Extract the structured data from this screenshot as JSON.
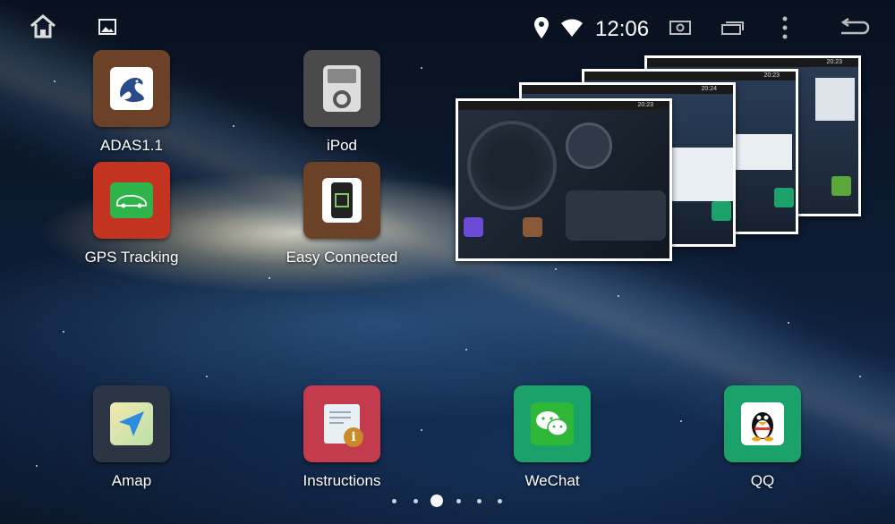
{
  "status_bar": {
    "time": "12:06",
    "icons": [
      "home-icon",
      "gallery-icon",
      "location-icon",
      "wifi-icon",
      "screenshot-icon",
      "recent-apps-icon",
      "overflow-menu-icon",
      "back-icon"
    ]
  },
  "apps": {
    "adas": {
      "label": "ADAS1.1",
      "color": "#6b4127",
      "icon": "dragon-icon"
    },
    "ipod": {
      "label": "iPod",
      "color": "#4a4a4a",
      "icon": "ipod-icon"
    },
    "gps": {
      "label": "GPS Tracking",
      "color": "#c2341f",
      "icon": "car-icon"
    },
    "easy": {
      "label": "Easy Connected",
      "color": "#6b4127",
      "icon": "phone-link-icon"
    },
    "amap": {
      "label": "Amap",
      "color": "#2b3543",
      "icon": "navigation-arrow-icon"
    },
    "instructions": {
      "label": "Instructions",
      "color": "#c33b4c",
      "icon": "document-info-icon"
    },
    "wechat": {
      "label": "WeChat",
      "color": "#1ba16a",
      "icon": "wechat-icon"
    },
    "qq": {
      "label": "QQ",
      "color": "#1ba16a",
      "icon": "penguin-icon"
    }
  },
  "recents": {
    "card1_time": "20:23",
    "card2_time": "20:24",
    "card4_time": "20:23"
  },
  "pager": {
    "pages": 6,
    "current": 3
  }
}
